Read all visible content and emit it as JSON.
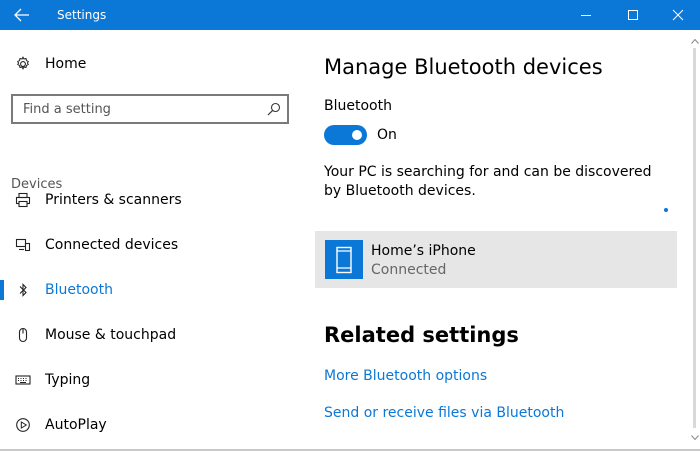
{
  "window": {
    "title": "Settings",
    "accent_color": "#0b78d7",
    "controls": [
      "minimize-icon",
      "maximize-icon",
      "close-icon"
    ]
  },
  "sidebar": {
    "home_label": "Home",
    "search_placeholder": "Find a setting",
    "section_label": "Devices",
    "items": [
      {
        "label": "Printers & scanners",
        "icon": "printer-icon",
        "active": false
      },
      {
        "label": "Connected devices",
        "icon": "connected-devices-icon",
        "active": false
      },
      {
        "label": "Bluetooth",
        "icon": "bluetooth-icon",
        "active": true
      },
      {
        "label": "Mouse & touchpad",
        "icon": "mouse-icon",
        "active": false
      },
      {
        "label": "Typing",
        "icon": "keyboard-icon",
        "active": false
      },
      {
        "label": "AutoPlay",
        "icon": "autoplay-icon",
        "active": false
      }
    ]
  },
  "main": {
    "title": "Manage Bluetooth devices",
    "bluetooth_label": "Bluetooth",
    "toggle_state": "On",
    "toggle_on": true,
    "status_text": "Your PC is searching for and can be discovered by Bluetooth devices.",
    "devices": [
      {
        "name": "Home’s iPhone",
        "status": "Connected",
        "icon": "phone-icon"
      }
    ],
    "related_title": "Related settings",
    "links": [
      "More Bluetooth options",
      "Send or receive files via Bluetooth"
    ]
  }
}
